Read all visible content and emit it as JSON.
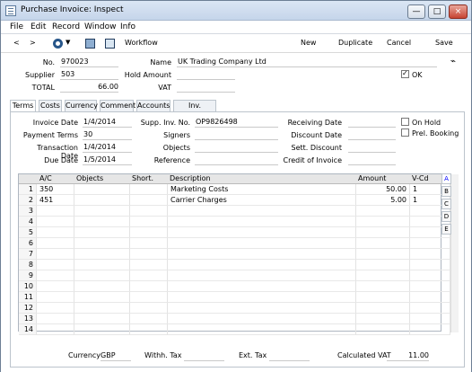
{
  "window": {
    "title": "Purchase Invoice: Inspect",
    "min": "—",
    "max": "□",
    "close": "×"
  },
  "menu": [
    "File",
    "Edit",
    "Record",
    "Window",
    "Info"
  ],
  "toolbar": {
    "back": "<",
    "forward": ">",
    "workflow": "Workflow",
    "new": "New",
    "duplicate": "Duplicate",
    "cancel": "Cancel",
    "save": "Save"
  },
  "header": {
    "no_label": "No.",
    "no": "970023",
    "name_label": "Name",
    "name": "UK Trading Company Ltd",
    "supplier_label": "Supplier",
    "supplier": "503",
    "hold_label": "Hold Amount",
    "ok_label": "OK",
    "total_label": "TOTAL",
    "total": "66.00",
    "vat_label": "VAT"
  },
  "tabs": [
    "Terms",
    "Costs",
    "Currency",
    "Comment",
    "Accounts",
    "Inv. Address"
  ],
  "terms": {
    "inv_date_label": "Invoice Date",
    "inv_date": "1/4/2014",
    "supp_inv_label": "Supp. Inv. No.",
    "supp_inv": "OP9826498",
    "recv_label": "Receiving Date",
    "on_hold": "On Hold",
    "pay_terms_label": "Payment Terms",
    "pay_terms": "30",
    "signers_label": "Signers",
    "discount_label": "Discount Date",
    "prel_label": "Prel. Booking",
    "trans_label": "Transaction Date",
    "trans": "1/4/2014",
    "objects_label": "Objects",
    "sett_label": "Sett. Discount",
    "due_label": "Due Date",
    "due": "1/5/2014",
    "reference_label": "Reference",
    "credit_label": "Credit of Invoice"
  },
  "grid": {
    "headers": [
      "A/C",
      "Objects",
      "Short.",
      "Description",
      "Amount",
      "V-Cd"
    ],
    "rows": [
      [
        "350",
        "",
        "",
        "Marketing Costs",
        "50.00",
        "1"
      ],
      [
        "451",
        "",
        "",
        "Carrier Charges",
        "5.00",
        "1"
      ]
    ],
    "row_numbers": [
      "1",
      "2",
      "3",
      "4",
      "5",
      "6",
      "7",
      "8",
      "9",
      "10",
      "11",
      "12",
      "13",
      "14"
    ],
    "sidetabs": [
      "A",
      "B",
      "C",
      "D",
      "E"
    ]
  },
  "footer": {
    "currency_label": "Currency",
    "currency": "GBP",
    "withh_label": "Withh. Tax",
    "ext_label": "Ext. Tax",
    "calc_label": "Calculated VAT",
    "calc": "11.00"
  }
}
